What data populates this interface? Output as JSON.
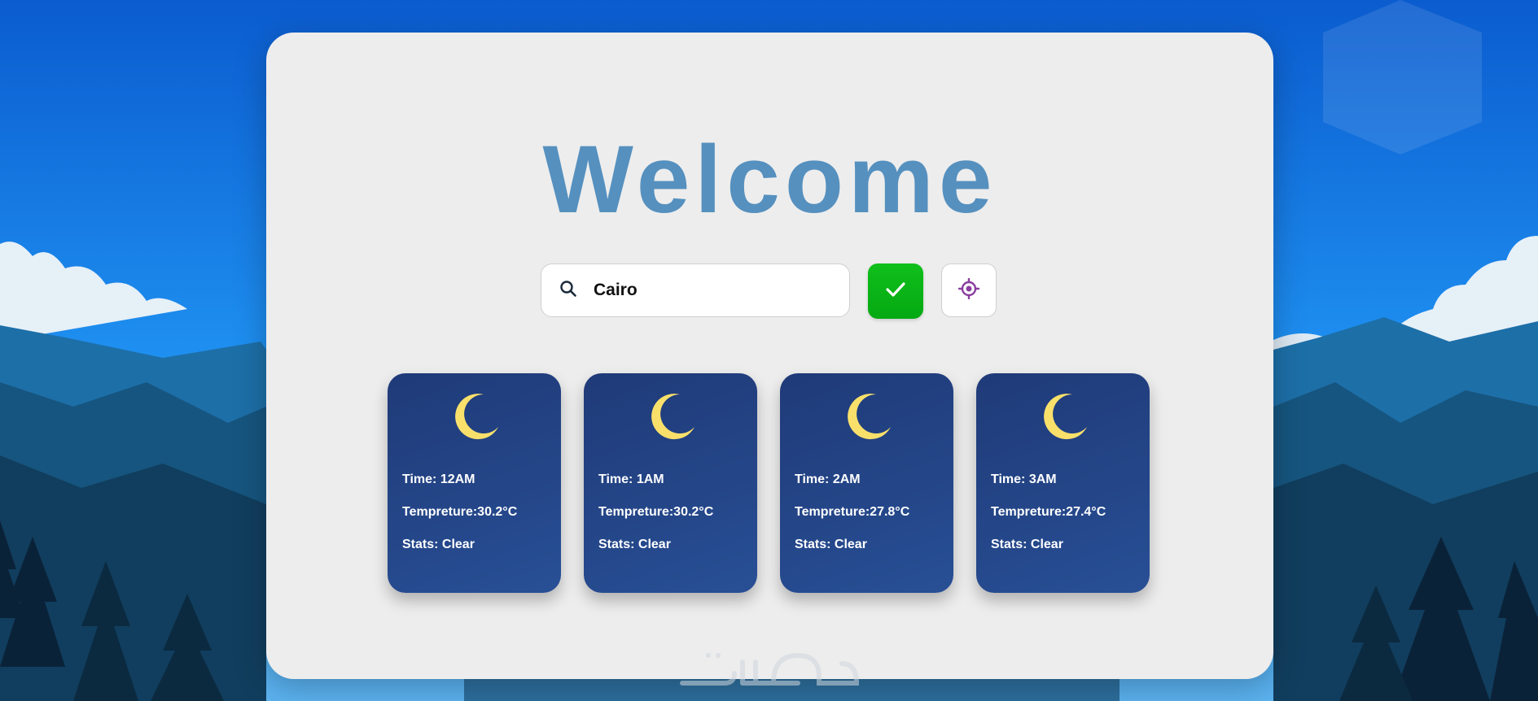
{
  "header": {
    "title": "Welcome"
  },
  "search": {
    "value": "Cairo",
    "icon": "search-icon"
  },
  "actions": {
    "submit_icon": "check-icon",
    "locate_icon": "crosshair-icon"
  },
  "forecast": [
    {
      "time_label": "Time: 12AM",
      "temp_label": "Tempreture:30.2°C",
      "stats_label": "Stats: Clear",
      "icon": "moon-icon"
    },
    {
      "time_label": "Time: 1AM",
      "temp_label": "Tempreture:30.2°C",
      "stats_label": "Stats: Clear",
      "icon": "moon-icon"
    },
    {
      "time_label": "Time: 2AM",
      "temp_label": "Tempreture:27.8°C",
      "stats_label": "Stats: Clear",
      "icon": "moon-icon"
    },
    {
      "time_label": "Time: 3AM",
      "temp_label": "Tempreture:27.4°C",
      "stats_label": "Stats: Clear",
      "icon": "moon-icon"
    }
  ],
  "watermark": {
    "text": "خمسات"
  },
  "colors": {
    "title": "#5590bf",
    "card_bg": "#ededed",
    "hour_card": "#243f82",
    "moon": "#f9e06b",
    "submit_button": "#07b115",
    "locate_icon": "#8b3f9f"
  }
}
